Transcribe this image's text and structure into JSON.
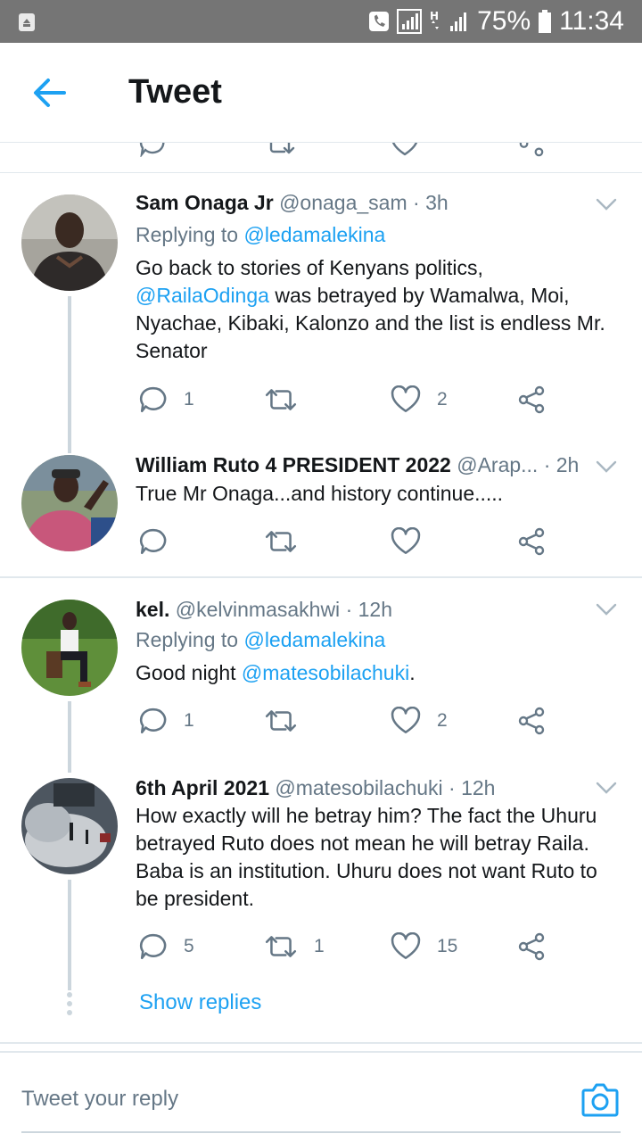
{
  "status_bar": {
    "battery": "75%",
    "time": "11:34"
  },
  "app_bar": {
    "title": "Tweet"
  },
  "tweets": [
    {
      "name": "Sam Onaga Jr",
      "handle": "@onaga_sam",
      "time": "· 3h",
      "replying_prefix": "Replying to",
      "replying_to": "@ledamalekina",
      "body_mention": "@RailaOdinga",
      "body_line1": "Go back to stories of Kenyans politics,",
      "body_line2_rest": " was betrayed by Wamalwa, Moi,",
      "body_line3": "Nyachae, Kibaki, Kalonzo and the list is endless Mr.",
      "body_line4": "Senator",
      "reply_count": "1",
      "retweet_count": "",
      "like_count": "2"
    },
    {
      "name": "William Ruto 4 PRESIDENT 2022",
      "handle": "@Arap...",
      "time": "· 2h",
      "body": "True Mr Onaga...and history continue.....",
      "reply_count": "",
      "retweet_count": "",
      "like_count": ""
    },
    {
      "name": "kel.",
      "handle": "@kelvinmasakhwi",
      "time": "· 12h",
      "replying_prefix": "Replying to",
      "replying_to": "@ledamalekina",
      "body_prefix": "Good night ",
      "body_mention": "@matesobilachuki",
      "body_suffix": ".",
      "reply_count": "1",
      "retweet_count": "",
      "like_count": "2"
    },
    {
      "name": "6th April 2021",
      "handle": "@matesobilachuki",
      "time": "· 12h",
      "body_line1": "How exactly will he betray him? The fact the Uhuru",
      "body_line2": "betrayed Ruto does not mean he will betray Raila.",
      "body_line3": "Baba is an institution. Uhuru does not want Ruto to",
      "body_line4": "be president.",
      "reply_count": "5",
      "retweet_count": "1",
      "like_count": "15"
    }
  ],
  "show_replies": "Show replies",
  "reply_bar": {
    "placeholder": "Tweet your reply"
  },
  "colors": {
    "accent": "#1da1f2",
    "muted": "#657786",
    "status_bar": "#757575",
    "divider": "#e1e8ed"
  }
}
